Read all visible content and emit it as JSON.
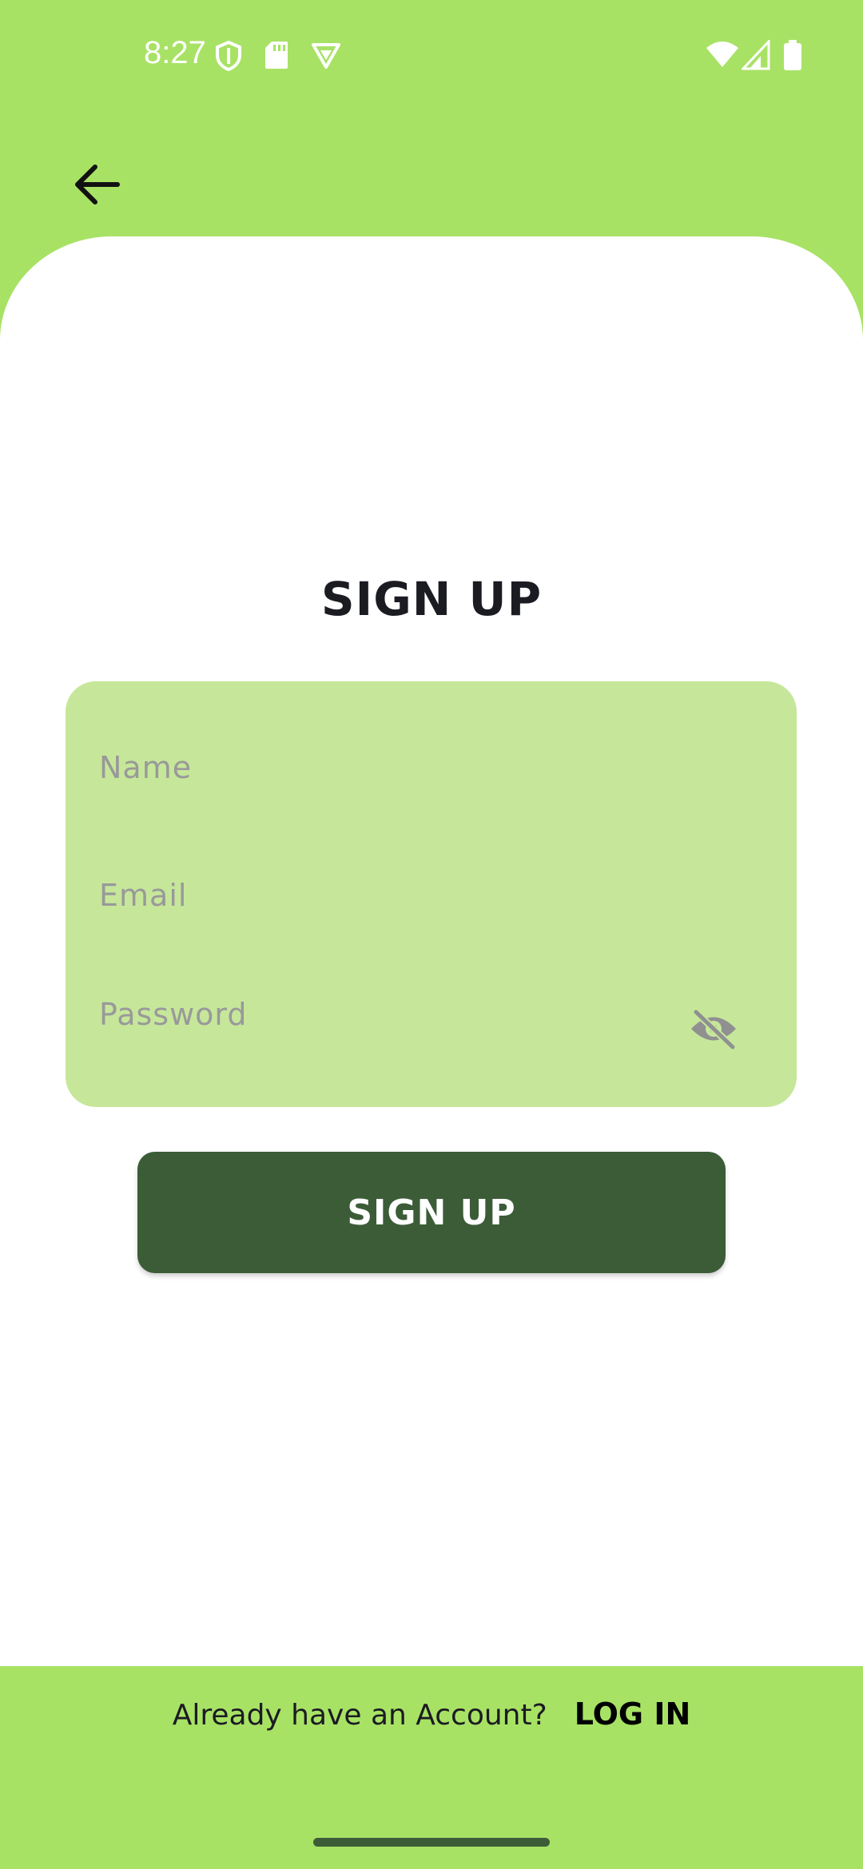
{
  "status_bar": {
    "time": "8:27",
    "icons": [
      "shield-icon",
      "sd-card-icon",
      "vpn-icon",
      "wifi-icon",
      "signal-icon",
      "battery-icon"
    ]
  },
  "nav": {
    "back_icon": "arrow-left-icon"
  },
  "title": "SIGN UP",
  "form": {
    "name_placeholder": "Name",
    "email_placeholder": "Email",
    "password_placeholder": "Password",
    "visibility_icon": "eye-off-icon"
  },
  "submit_label": "SIGN UP",
  "footer": {
    "prompt": "Already have an Account?",
    "link_label": "LOG IN"
  },
  "colors": {
    "accent_green": "#a8e265",
    "panel_green": "#c6e79a",
    "button_dark_green": "#3b5c37",
    "text_dark": "#1b1b22",
    "placeholder_gray": "#999999"
  }
}
